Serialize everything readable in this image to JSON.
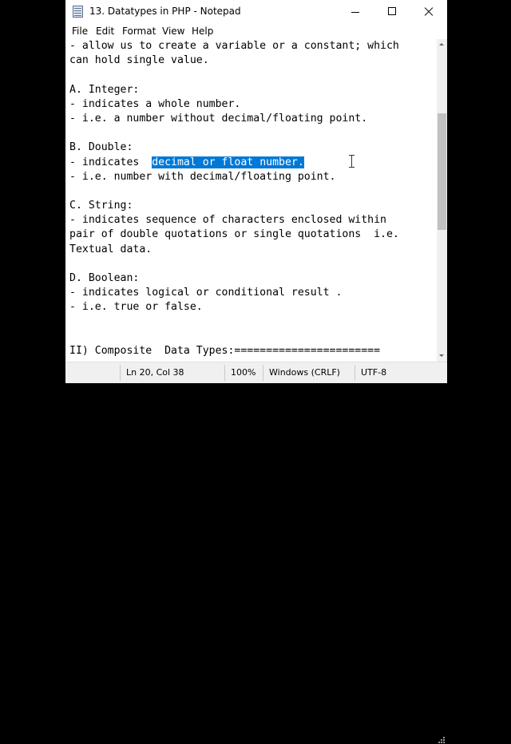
{
  "window": {
    "title": "13. Datatypes in PHP - Notepad",
    "caption_buttons": {
      "minimize": "minimize-icon",
      "maximize": "maximize-icon",
      "close": "close-icon"
    }
  },
  "menu": [
    "File",
    "Edit",
    "Format",
    "View",
    "Help"
  ],
  "editor": {
    "lines": [
      "- allow us to create a variable or a constant; which",
      "can hold single value.",
      "",
      "A. Integer:",
      "- indicates a whole number.",
      "- i.e. a number without decimal/floating point.",
      "",
      "B. Double:",
      "- indicates  ",
      "- i.e. number with decimal/floating point.",
      "",
      "C. String:",
      "- indicates sequence of characters enclosed within",
      "pair of double quotations or single quotations  i.e.",
      "Textual data.",
      "",
      "D. Boolean:",
      "- indicates logical or conditional result .",
      "- i.e. true or false.",
      "",
      "",
      "II) Composite  Data Types:======================="
    ],
    "selected_text": "decimal or float number."
  },
  "status": {
    "position": "Ln 20, Col 38",
    "zoom": "100%",
    "line_ending": "Windows (CRLF)",
    "encoding": "UTF-8"
  },
  "colors": {
    "selection": "#0078d7",
    "statusbar_bg": "#f0f0f0"
  }
}
